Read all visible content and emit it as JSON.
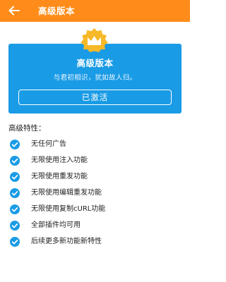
{
  "app_bar": {
    "title": "高级版本",
    "back_icon": "arrow-left-icon",
    "background": "#ff8c1a"
  },
  "card": {
    "badge_icon": "crown-icon",
    "title": "高级版本",
    "subtitle": "与君初相识，犹如故人归。",
    "button_label": "已激活",
    "background": "#1a9be5"
  },
  "features": {
    "heading": "高级特性：",
    "check_icon": "check-circle-icon",
    "items": [
      "无任何广告",
      "无限使用注入功能",
      "无限使用重发功能",
      "无限使用编辑重发功能",
      "无限使用复制cURL功能",
      "全部插件均可用",
      "后续更多新功能新特性"
    ]
  }
}
